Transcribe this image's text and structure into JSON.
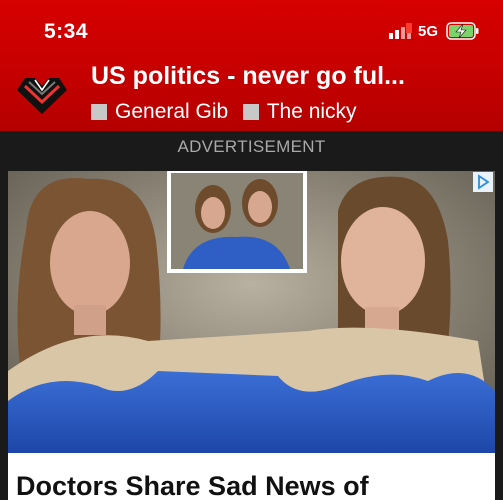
{
  "status_bar": {
    "time": "5:34",
    "network": "5G",
    "icons": [
      "signal-icon",
      "battery-charging-icon"
    ]
  },
  "topic": {
    "title": "US politics - never go ful...",
    "tags": [
      {
        "label": "General Gib"
      },
      {
        "label": "The nicky"
      }
    ]
  },
  "ad": {
    "label": "ADVERTISEMENT",
    "headline": "Doctors Share Sad News of",
    "icon": "ad-choices-icon"
  },
  "colors": {
    "header_red": "#c60000",
    "tag_square": "#c8c8c8",
    "background": "#1a1a1a"
  }
}
